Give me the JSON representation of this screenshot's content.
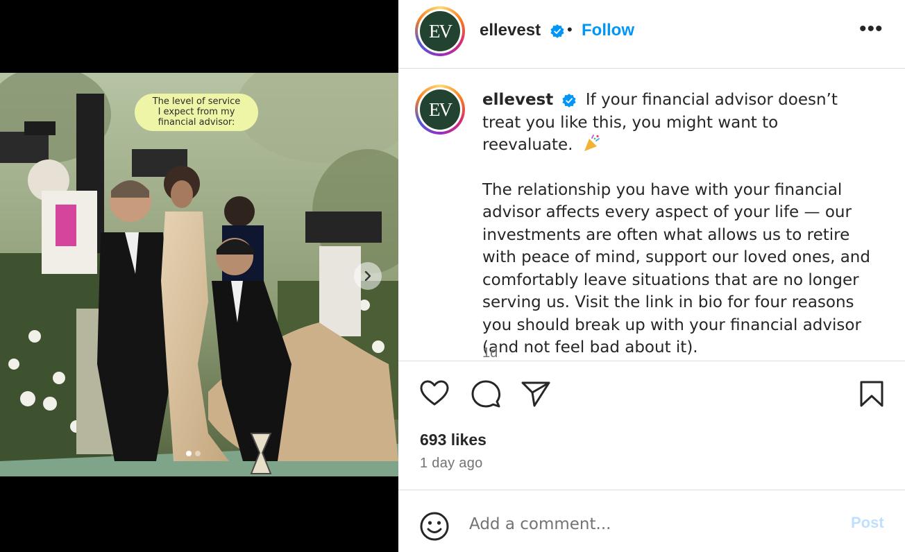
{
  "media": {
    "overlay_text": [
      "The level of service",
      "I expect from my",
      "financial advisor:"
    ],
    "carousel": {
      "count": 2,
      "active_index": 0
    }
  },
  "header": {
    "avatar_text": "EV",
    "username": "ellevest",
    "separator": "•",
    "follow_label": "Follow",
    "more_label": "•••"
  },
  "caption": {
    "avatar_text": "EV",
    "username": "ellevest",
    "line1": "If your financial advisor doesn’t treat you like this, you might want to reevaluate.",
    "emoji": "confetti-icon",
    "paragraph": "The relationship you have with your financial advisor affects every aspect of your life — our investments are often what allows us to retire with peace of mind, support our loved ones, and comfortably leave situations that are no longer serving us. Visit the link in bio for four reasons you should break up with your financial advisor (and not feel bad about it).",
    "time": "1d"
  },
  "actions": {
    "like": "heart-icon",
    "comment": "comment-icon",
    "share": "share-icon",
    "save": "bookmark-icon"
  },
  "stats": {
    "likes": "693 likes",
    "posted": "1 day ago"
  },
  "comment": {
    "placeholder": "Add a comment...",
    "post_label": "Post"
  },
  "colors": {
    "link": "#0095f6",
    "verified": "#0095f6",
    "brand": "#22432f",
    "post_disabled": "#c0dffd"
  }
}
